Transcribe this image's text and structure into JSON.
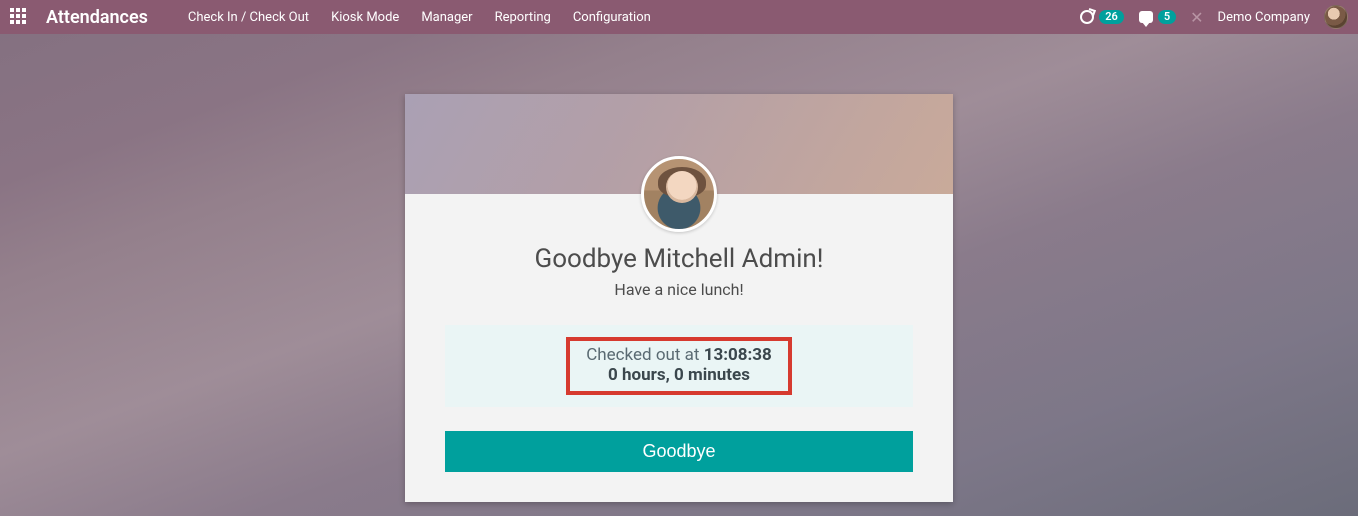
{
  "nav": {
    "brand": "Attendances",
    "links": [
      "Check In / Check Out",
      "Kiosk Mode",
      "Manager",
      "Reporting",
      "Configuration"
    ],
    "activities_count": "26",
    "messages_count": "5",
    "company": "Demo Company"
  },
  "card": {
    "greeting": "Goodbye Mitchell Admin!",
    "subtitle": "Have a nice lunch!",
    "checked_out_label": "Checked out at ",
    "checked_out_time": "13:08:38",
    "duration": "0 hours, 0 minutes",
    "button_label": "Goodbye"
  }
}
